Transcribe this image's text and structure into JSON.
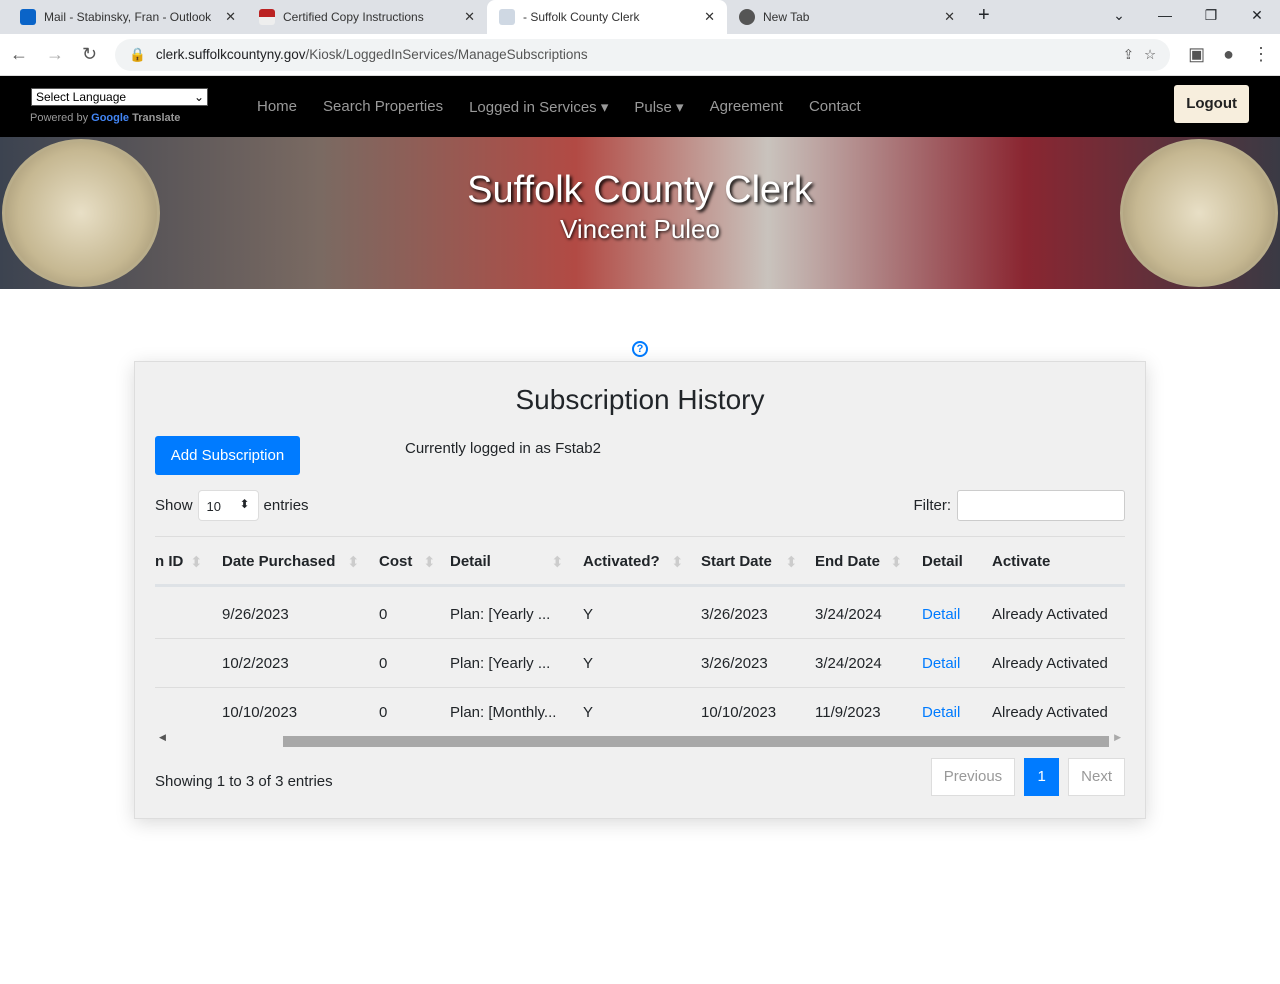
{
  "browser": {
    "tabs": [
      {
        "title": "Mail - Stabinsky, Fran - Outlook"
      },
      {
        "title": "Certified Copy Instructions"
      },
      {
        "title": "- Suffolk County Clerk"
      },
      {
        "title": "New Tab"
      }
    ],
    "url_domain": "clerk.suffolkcountyny.gov",
    "url_path": "/Kiosk/LoggedInServices/ManageSubscriptions"
  },
  "nav": {
    "language": "Select Language",
    "powered_by": "Powered by",
    "google": "Google",
    "translate": "Translate",
    "items": [
      "Home",
      "Search Properties",
      "Logged in Services ▾",
      "Pulse ▾",
      "Agreement",
      "Contact"
    ],
    "logout": "Logout"
  },
  "banner": {
    "title": "Suffolk County Clerk",
    "subtitle": "Vincent Puleo"
  },
  "main": {
    "title": "Subscription History",
    "add_button": "Add Subscription",
    "logged_in": "Currently logged in as Fstab2",
    "show": "Show",
    "entries_value": "10",
    "entries": "entries",
    "filter": "Filter:",
    "columns": [
      "n ID",
      "Date Purchased",
      "Cost",
      "Detail",
      "Activated?",
      "Start Date",
      "End Date",
      "Detail",
      "Activate"
    ],
    "rows": [
      [
        "",
        "9/26/2023",
        "0",
        "Plan: [Yearly ...",
        "Y",
        "3/26/2023",
        "3/24/2024",
        "Detail",
        "Already Activated"
      ],
      [
        "",
        "10/2/2023",
        "0",
        "Plan: [Yearly ...",
        "Y",
        "3/26/2023",
        "3/24/2024",
        "Detail",
        "Already Activated"
      ],
      [
        "",
        "10/10/2023",
        "0",
        "Plan: [Monthly...",
        "Y",
        "10/10/2023",
        "11/9/2023",
        "Detail",
        "Already Activated"
      ]
    ],
    "showing": "Showing 1 to 3 of 3 entries",
    "previous": "Previous",
    "page": "1",
    "next": "Next"
  },
  "colors": {
    "accent": "#007bff",
    "navbar": "#000000"
  }
}
